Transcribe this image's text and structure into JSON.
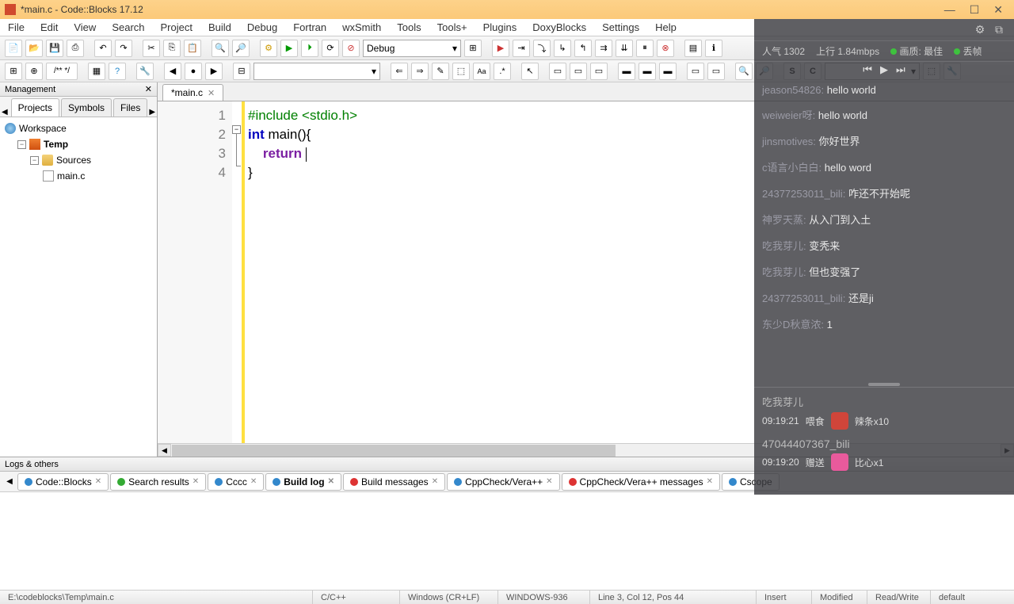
{
  "title": "*main.c - Code::Blocks 17.12",
  "menu": [
    "File",
    "Edit",
    "View",
    "Search",
    "Project",
    "Build",
    "Debug",
    "Fortran",
    "wxSmith",
    "Tools",
    "Tools+",
    "Plugins",
    "DoxyBlocks",
    "Settings",
    "Help"
  ],
  "build_target": "Debug",
  "management": {
    "title": "Management",
    "tabs": [
      "Projects",
      "Symbols",
      "Files"
    ],
    "tree": {
      "workspace": "Workspace",
      "project": "Temp",
      "folder": "Sources",
      "file": "main.c"
    }
  },
  "editor": {
    "tab": "*main.c",
    "lines": [
      "1",
      "2",
      "3",
      "4"
    ],
    "code": {
      "l1_preproc": "#include <stdio.h>",
      "l2_kw": "int",
      "l2_rest": " main(){",
      "l3_kw": "return",
      "l3_rest": " ",
      "l4": "}"
    }
  },
  "logs": {
    "title": "Logs & others",
    "tabs": [
      "Code::Blocks",
      "Search results",
      "Cccc",
      "Build log",
      "Build messages",
      "CppCheck/Vera++",
      "CppCheck/Vera++ messages",
      "Cscope"
    ]
  },
  "status": {
    "path": "E:\\codeblocks\\Temp\\main.c",
    "lang": "C/C++",
    "enc1": "Windows (CR+LF)",
    "enc2": "WINDOWS-936",
    "pos": "Line 3, Col 12, Pos 44",
    "insert": "Insert",
    "modified": "Modified",
    "rw": "Read/Write",
    "default": "default"
  },
  "stream": {
    "popularity_label": "人气",
    "popularity": "1302",
    "up_label": "上行",
    "up": "1.84mbps",
    "quality_label": "画质:",
    "quality": "最佳",
    "drop_label": "丢帧",
    "chat": [
      {
        "user": "jeason54826:",
        "msg": "hello world"
      },
      {
        "user": "weiweier呀:",
        "msg": "hello world"
      },
      {
        "user": "jinsmotives:",
        "msg": "你好世界"
      },
      {
        "user": "c语言小白白:",
        "msg": "hello word"
      },
      {
        "user": "24377253011_bili:",
        "msg": "咋还不开始呢"
      },
      {
        "user": "神罗天蒸:",
        "msg": "从入门到入土"
      },
      {
        "user": "吃我芽儿:",
        "msg": "变秃来"
      },
      {
        "user": "吃我芽儿:",
        "msg": "但也变强了"
      },
      {
        "user": "24377253011_bili:",
        "msg": "还是ji"
      },
      {
        "user": "东少D秋意浓:",
        "msg": "1"
      }
    ],
    "gifts": [
      {
        "user": "吃我芽儿",
        "time": "09:19:21",
        "action": "喂食",
        "item": "辣条x10"
      },
      {
        "user": "47044407367_bili",
        "time": "09:19:20",
        "action": "赠送",
        "item": "比心x1"
      }
    ]
  }
}
